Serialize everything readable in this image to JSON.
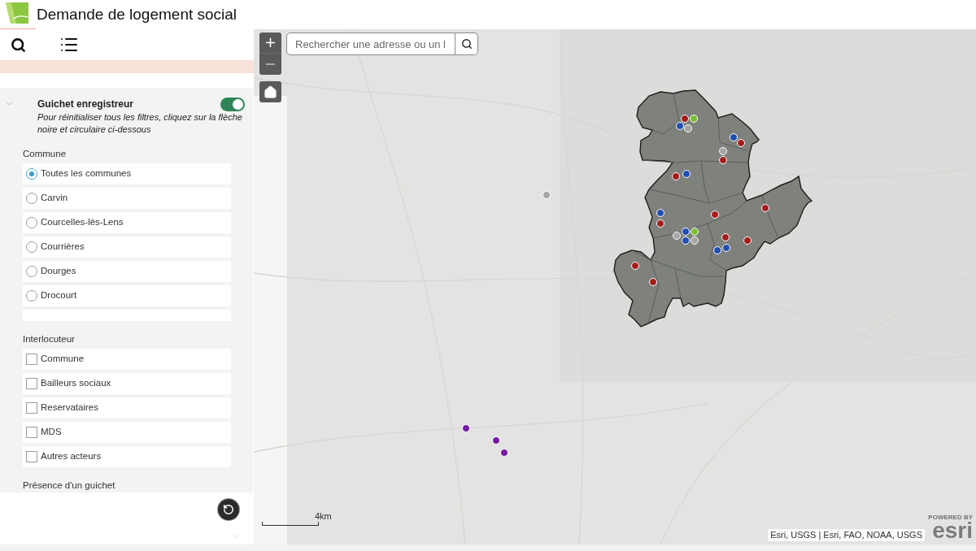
{
  "header": {
    "title": "Demande de logement social"
  },
  "sidebar_tabs": [
    {
      "kind": "search"
    },
    {
      "kind": "list"
    }
  ],
  "filter_panel": {
    "expanded": true,
    "title": "Guichet enregistreur",
    "on": true,
    "hint": "Pour réinitialiser tous les filtres, cliquez sur la flèche noire et circulaire ci-dessous",
    "groups": [
      {
        "label": "Commune",
        "kind": "radio",
        "more_below": true,
        "options": [
          {
            "label": "Toutes les communes",
            "selected": true
          },
          {
            "label": "Carvin",
            "selected": false
          },
          {
            "label": "Courcelles-lès-Lens",
            "selected": false
          },
          {
            "label": "Courrières",
            "selected": false
          },
          {
            "label": "Dourges",
            "selected": false
          },
          {
            "label": "Drocourt",
            "selected": false
          }
        ]
      },
      {
        "label": "Interlocuteur",
        "kind": "checkbox",
        "options": [
          {
            "label": "Commune",
            "checked": false
          },
          {
            "label": "Bailleurs sociaux",
            "checked": false
          },
          {
            "label": "Reservataires",
            "checked": false
          },
          {
            "label": "MDS",
            "checked": false
          },
          {
            "label": "Autres acteurs",
            "checked": false
          }
        ]
      },
      {
        "label": "Présence d'un guichet"
      }
    ]
  },
  "map": {
    "controls": [
      {
        "kind": "zoom_in",
        "disabled": false
      },
      {
        "kind": "zoom_out",
        "disabled": true
      },
      {
        "kind": "home",
        "disabled": false
      }
    ],
    "search": {
      "placeholder": "Rechercher une adresse ou un l"
    },
    "markers": [
      {
        "color": "#a51c1c"
      },
      {
        "color": "#7bbf2e"
      },
      {
        "color": "#1f4fb3"
      },
      {
        "color": "#a5a5a5"
      },
      {
        "color": "#1f4fb3"
      },
      {
        "color": "#a51c1c"
      },
      {
        "color": "#a5a5a5"
      },
      {
        "color": "#a51c1c"
      },
      {
        "color": "#1f4fb3"
      },
      {
        "color": "#a51c1c"
      },
      {
        "color": "#a5a5a5"
      },
      {
        "color": "#a51c1c"
      },
      {
        "color": "#1f4fb3"
      },
      {
        "color": "#a51c1c"
      },
      {
        "color": "#a51c1c"
      },
      {
        "color": "#1f4fb3"
      },
      {
        "color": "#a5a5a5"
      },
      {
        "color": "#7bbf2e"
      },
      {
        "color": "#a51c1c"
      },
      {
        "color": "#1f4fb3"
      },
      {
        "color": "#a5a5a5"
      },
      {
        "color": "#a51c1c"
      },
      {
        "color": "#1f4fb3"
      },
      {
        "color": "#1f4fb3"
      },
      {
        "color": "#a51c1c"
      },
      {
        "color": "#a51c1c"
      },
      {
        "color": "#751ca3"
      },
      {
        "color": "#751ca3"
      },
      {
        "color": "#751ca3"
      }
    ],
    "scale": "4km",
    "attribution": "Esri, USGS | Esri, FAO, NOAA, USGS",
    "logo": {
      "tagline": "POWERED BY",
      "wordmark": "esri"
    }
  }
}
